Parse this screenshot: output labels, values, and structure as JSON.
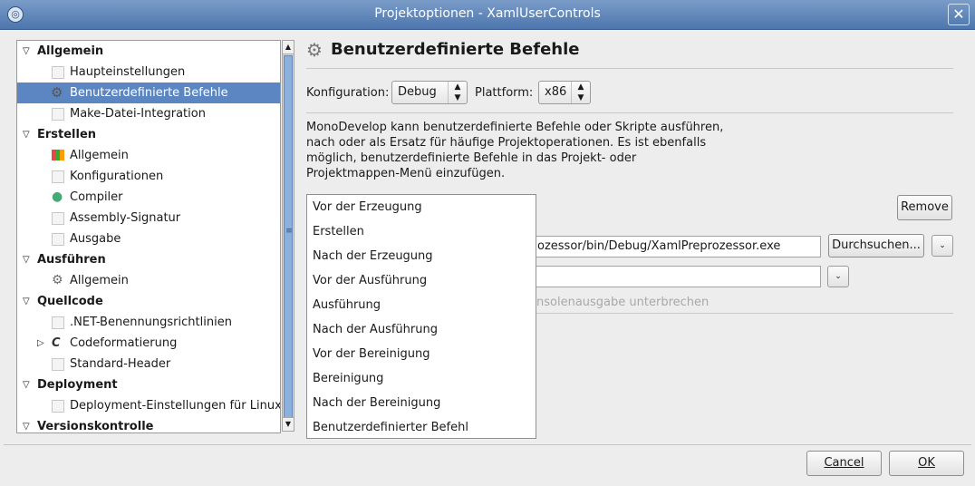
{
  "window": {
    "title": "Projektoptionen - XamlUserControls"
  },
  "tree": {
    "rows": [
      {
        "label": "Allgemein",
        "kind": "category",
        "icon": "triangle-down-icon"
      },
      {
        "label": "Haupteinstellungen",
        "kind": "item",
        "icon": "blank-icon"
      },
      {
        "label": "Benutzerdefinierte Befehle",
        "kind": "item",
        "icon": "gear-icon",
        "selected": true
      },
      {
        "label": "Make-Datei-Integration",
        "kind": "item",
        "icon": "blank-icon"
      },
      {
        "label": "Erstellen",
        "kind": "category",
        "icon": "triangle-down-icon"
      },
      {
        "label": "Allgemein",
        "kind": "item",
        "icon": "hierarchy-icon"
      },
      {
        "label": "Konfigurationen",
        "kind": "item",
        "icon": "blank-icon"
      },
      {
        "label": "Compiler",
        "kind": "item",
        "icon": "compiler-icon"
      },
      {
        "label": "Assembly-Signatur",
        "kind": "item",
        "icon": "blank-icon"
      },
      {
        "label": "Ausgabe",
        "kind": "item",
        "icon": "blank-icon"
      },
      {
        "label": "Ausführen",
        "kind": "category",
        "icon": "triangle-down-icon"
      },
      {
        "label": "Allgemein",
        "kind": "item",
        "icon": "cogs-icon"
      },
      {
        "label": "Quellcode",
        "kind": "category",
        "icon": "triangle-down-icon"
      },
      {
        "label": ".NET-Benennungsrichtlinien",
        "kind": "item",
        "icon": "blank-icon"
      },
      {
        "label": "Codeformatierung",
        "kind": "item",
        "icon": "code-format-icon",
        "expandable": true
      },
      {
        "label": "Standard-Header",
        "kind": "item",
        "icon": "blank-icon"
      },
      {
        "label": "Deployment",
        "kind": "category",
        "icon": "triangle-down-icon"
      },
      {
        "label": "Deployment-Einstellungen für Linux",
        "kind": "item",
        "icon": "blank-icon"
      },
      {
        "label": "Versionskontrolle",
        "kind": "category",
        "icon": "triangle-down-icon"
      }
    ]
  },
  "panel": {
    "header": "Benutzerdefinierte Befehle",
    "konfiguration_label": "Konfiguration:",
    "konfiguration_value": "Debug",
    "plattform_label": "Plattform:",
    "plattform_value": "x86",
    "description": "MonoDevelop kann benutzerdefinierte Befehle oder Skripte ausführen, nach oder als Ersatz für häufige Projektoperationen. Es ist ebenfalls möglich, benutzerdefinierte Befehle in das Projekt- oder Projektmappen-Menü einzufügen.",
    "remove_label": "Remove",
    "command_value": "ozessor/bin/Debug/XamlPreprozessor.exe",
    "browse_label": "Durchsuchen...",
    "workdir_value": "",
    "pause_text": "nsolenausgabe unterbrechen"
  },
  "popup": {
    "options": [
      "Vor der Erzeugung",
      "Erstellen",
      "Nach der Erzeugung",
      "Vor der Ausführung",
      "Ausführung",
      "Nach der Ausführung",
      "Vor der Bereinigung",
      "Bereinigung",
      "Nach der Bereinigung",
      "Benutzerdefinierter Befehl"
    ]
  },
  "footer": {
    "cancel_label": "Cancel",
    "ok_label": "OK"
  }
}
